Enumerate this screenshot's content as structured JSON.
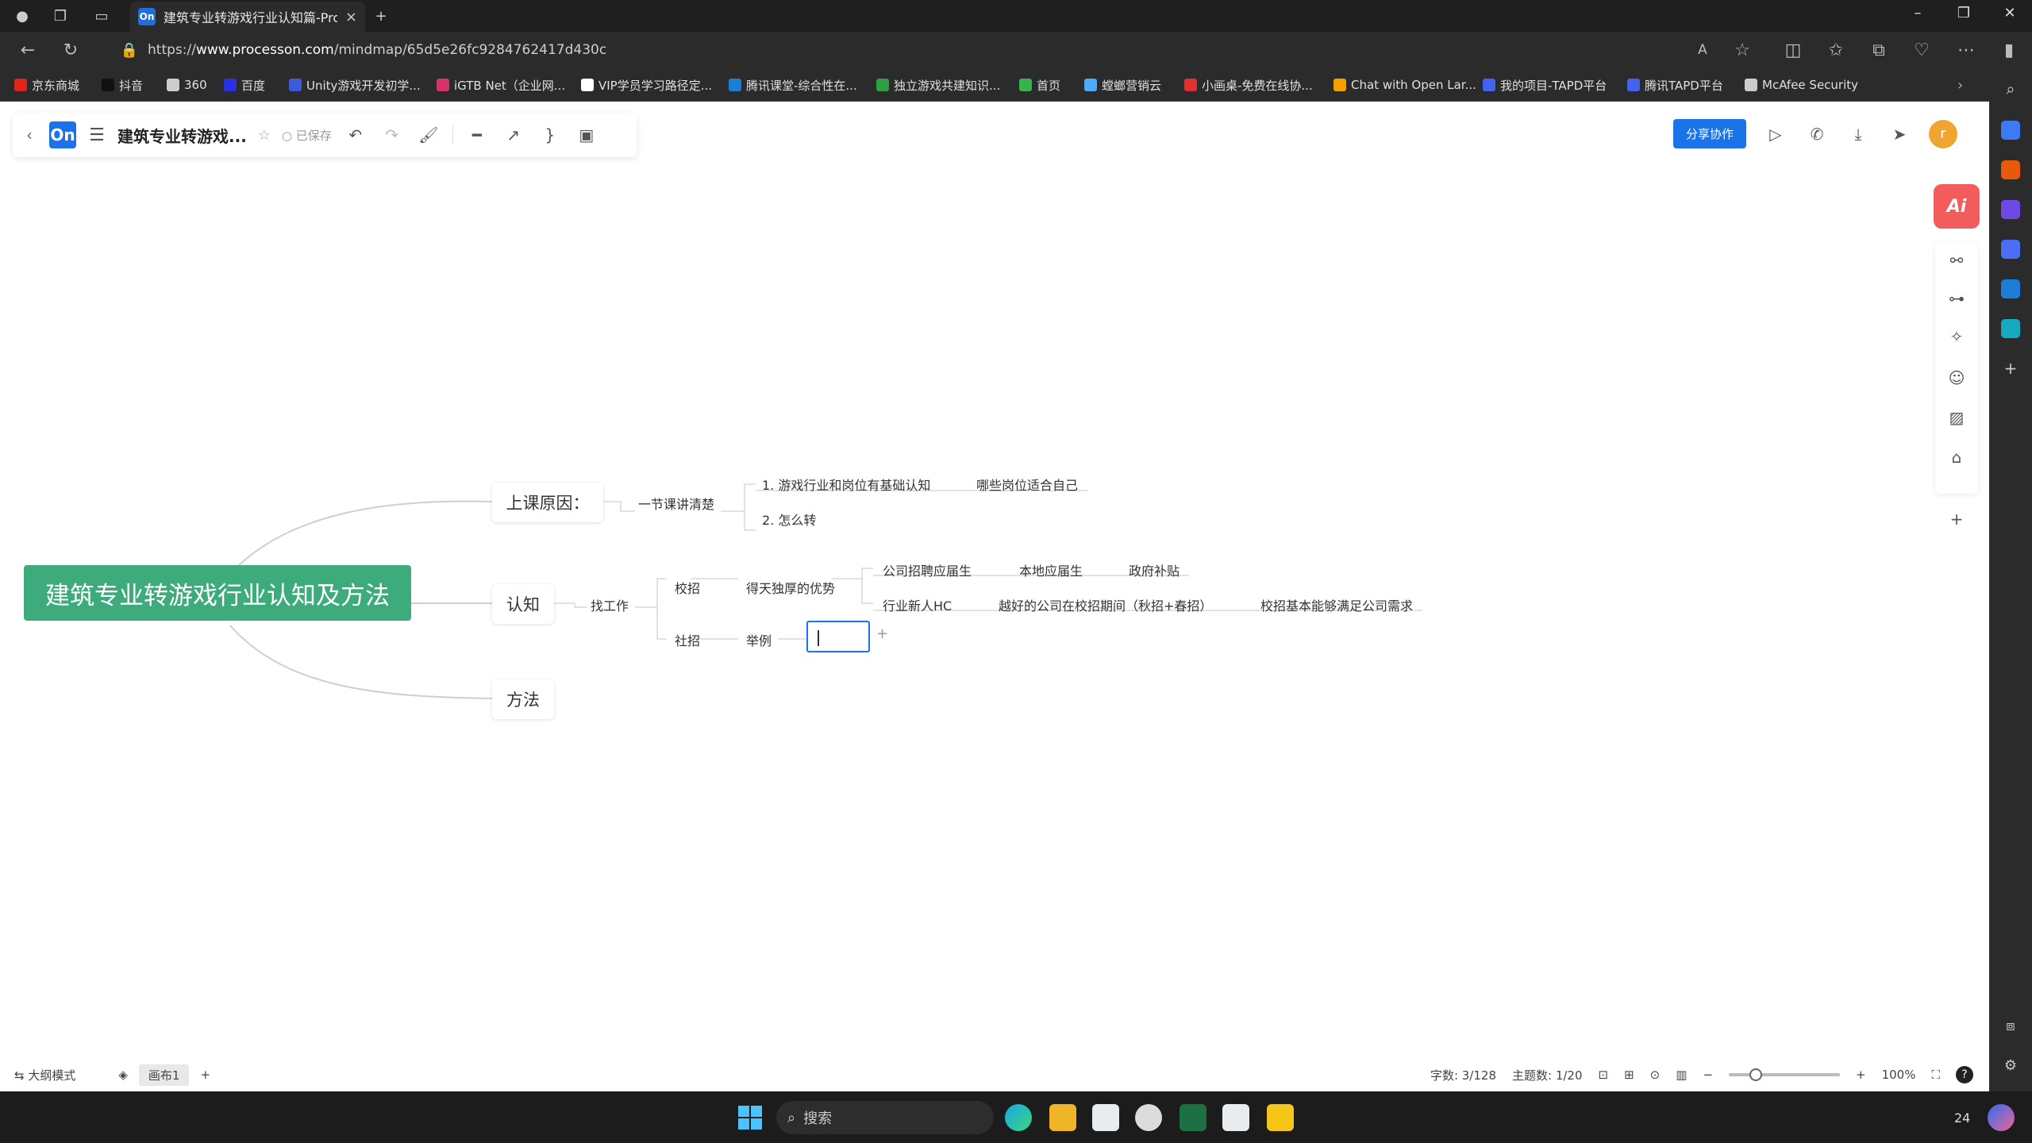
{
  "browser": {
    "tab_title": "建筑专业转游戏行业认知篇-Proc",
    "tab_favicon": "On",
    "url_prefix": "https://",
    "url_host": "www.processon.com",
    "url_path": "/mindmap/65d5e26fc9284762417d430c",
    "bookmarks": [
      {
        "label": "京东商城",
        "color": "#e1251b"
      },
      {
        "label": "抖音",
        "color": "#111111"
      },
      {
        "label": "360",
        "color": "#cccccc"
      },
      {
        "label": "百度",
        "color": "#2932e1"
      },
      {
        "label": "Unity游戏开发初学...",
        "color": "#3b5bdb"
      },
      {
        "label": "iGTB Net（企业网...",
        "color": "#d6336c"
      },
      {
        "label": "VIP学员学习路径定...",
        "color": "#ffffff"
      },
      {
        "label": "腾讯课堂-综合性在...",
        "color": "#1c7ed6"
      },
      {
        "label": "独立游戏共建知识...",
        "color": "#2f9e44"
      },
      {
        "label": "首页",
        "color": "#37b24d"
      },
      {
        "label": "螳螂营销云",
        "color": "#4dabf7"
      },
      {
        "label": "小画桌-免费在线协...",
        "color": "#e03131"
      },
      {
        "label": "Chat with Open Lar...",
        "color": "#f59f00"
      },
      {
        "label": "我的项目-TAPD平台",
        "color": "#4263eb"
      },
      {
        "label": "腾讯TAPD平台",
        "color": "#4263eb"
      },
      {
        "label": "McAfee Security",
        "color": "#cccccc"
      }
    ]
  },
  "app": {
    "logo": "On",
    "doc_title": "建筑专业转游戏...",
    "saved_status": "已保存",
    "share_label": "分享协作",
    "avatar_letter": "r",
    "ai_label": "Ai"
  },
  "mindmap": {
    "root": "建筑专业转游戏行业认知及方法",
    "branches": {
      "reason": "上课原因：",
      "cognition": "认知",
      "method": "方法"
    },
    "labels": {
      "one_lesson": "一节课讲清楚",
      "basic_cognition": "1. 游戏行业和岗位有基础认知",
      "which_positions": "哪些岗位适合自己",
      "how_to_switch": "2. 怎么转",
      "find_job": "找工作",
      "campus": "校招",
      "unique_adv": "得天独厚的优势",
      "company_grad": "公司招聘应届生",
      "local_grad": "本地应届生",
      "gov_subsidy": "政府补贴",
      "newcomer_hc": "行业新人HC",
      "better_company": "越好的公司在校招期间（秋招+春招）",
      "campus_basic": "校招基本能够满足公司需求",
      "social": "社招",
      "example": "举例"
    }
  },
  "bottom": {
    "outline_mode": "大纲模式",
    "sheet": "画布1",
    "word_count": "字数: 3/128",
    "topic_count": "主题数: 1/20",
    "zoom": "100%"
  },
  "taskbar": {
    "search_placeholder": "搜索",
    "tray_text": "24"
  }
}
